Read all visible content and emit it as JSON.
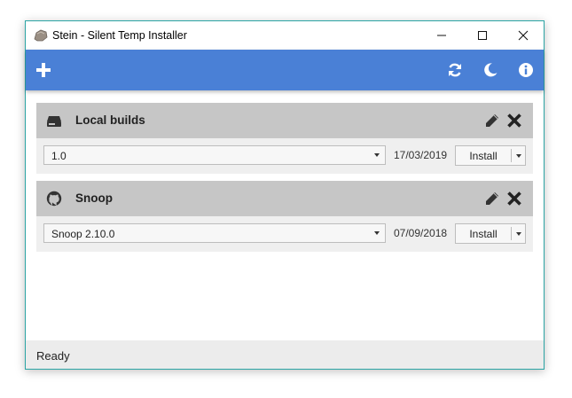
{
  "window": {
    "title": "Stein - Silent Temp Installer",
    "minimize_icon": "minimize-icon",
    "maximize_icon": "maximize-icon",
    "close_icon": "close-icon"
  },
  "toolbar": {
    "add_icon": "plus-icon",
    "refresh_icon": "refresh-icon",
    "theme_icon": "moon-icon",
    "info_icon": "info-icon",
    "color": "#4a80d6"
  },
  "sources": [
    {
      "name": "Local builds",
      "icon": "drive-icon",
      "selected_version": "1.0",
      "date": "17/03/2019",
      "install_label": "Install"
    },
    {
      "name": "Snoop",
      "icon": "github-icon",
      "selected_version": "Snoop 2.10.0",
      "date": "07/09/2018",
      "install_label": "Install"
    }
  ],
  "status": {
    "text": "Ready"
  }
}
